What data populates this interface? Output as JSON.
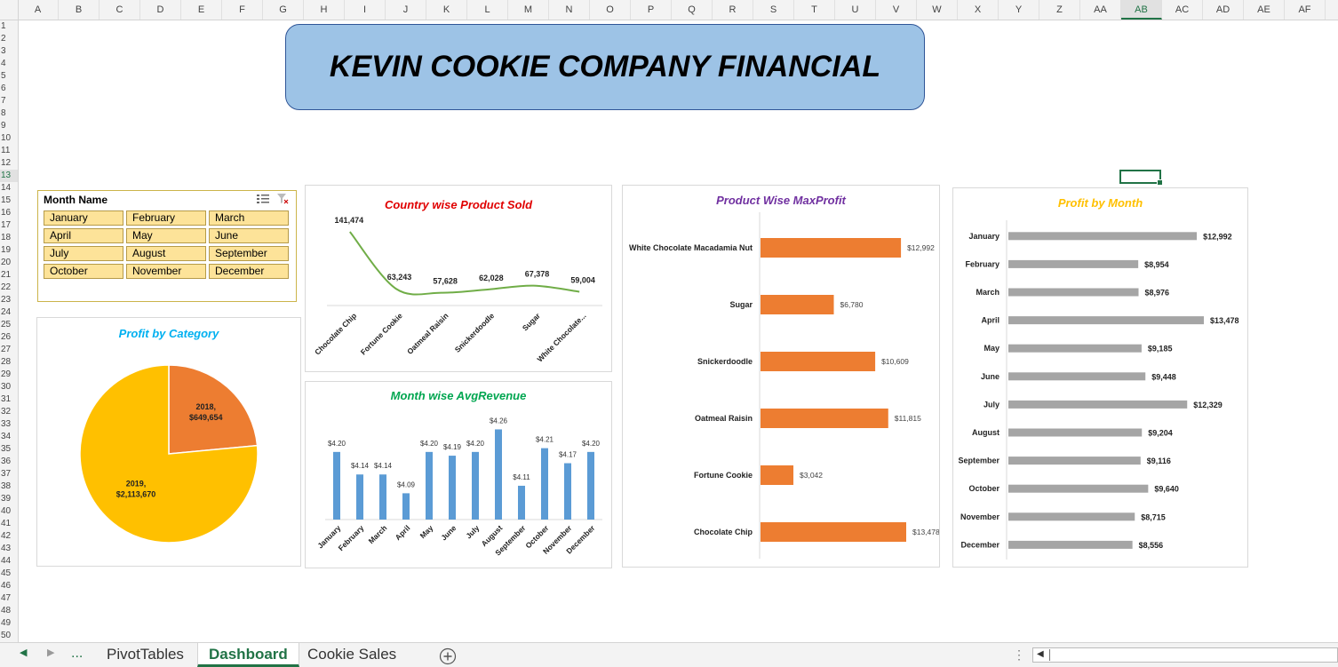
{
  "grid": {
    "columns": [
      "A",
      "B",
      "C",
      "D",
      "E",
      "F",
      "G",
      "H",
      "I",
      "J",
      "K",
      "L",
      "M",
      "N",
      "O",
      "P",
      "Q",
      "R",
      "S",
      "T",
      "U",
      "V",
      "W",
      "X",
      "Y",
      "Z",
      "AA",
      "AB",
      "AC",
      "AD",
      "AE",
      "AF"
    ],
    "selected_column": "AB",
    "rows": [
      "1",
      "2",
      "3",
      "4",
      "5",
      "6",
      "7",
      "8",
      "9",
      "10",
      "11",
      "12",
      "13",
      "14",
      "15",
      "16",
      "17",
      "18",
      "19",
      "20",
      "21",
      "22",
      "23",
      "24",
      "25",
      "26",
      "27",
      "28",
      "29",
      "30",
      "31",
      "32",
      "33",
      "34",
      "35",
      "36",
      "37",
      "38",
      "39",
      "40",
      "41",
      "42",
      "43",
      "44",
      "45",
      "46",
      "47",
      "48",
      "49",
      "50"
    ],
    "selected_row": "13"
  },
  "dashboard": {
    "title": "KEVIN COOKIE COMPANY FINANCIAL"
  },
  "slicer": {
    "title": "Month Name",
    "items": [
      "January",
      "February",
      "March",
      "April",
      "May",
      "June",
      "July",
      "August",
      "September",
      "October",
      "November",
      "December"
    ],
    "icons": [
      "multi-select-icon",
      "clear-filter-icon"
    ]
  },
  "charts": {
    "country_product_sold": {
      "title": "Country wise Product Sold",
      "title_color": "#e00000"
    },
    "month_avg_revenue": {
      "title": "Month wise AvgRevenue",
      "title_color": "#00a650"
    },
    "product_max_profit": {
      "title": "Product Wise MaxProfit",
      "title_color": "#7030a0"
    },
    "profit_by_month": {
      "title": "Profit by Month",
      "title_color": "#ffc000"
    },
    "profit_by_category": {
      "title": "Profit by Category",
      "title_color": "#00b0f0"
    }
  },
  "chart_data": [
    {
      "id": "country_product_sold",
      "type": "line",
      "title": "Country wise Product Sold",
      "categories": [
        "Chocolate Chip",
        "Fortune Cookie",
        "Oatmeal Raisin",
        "Snickerdoodle",
        "Sugar",
        "White Chocolate..."
      ],
      "values": [
        141474,
        63243,
        57628,
        62028,
        67378,
        59004
      ],
      "labels": [
        "141,474",
        "63,243",
        "57,628",
        "62,028",
        "67,378",
        "59,004"
      ],
      "color": "#70ad47",
      "smooth": true
    },
    {
      "id": "month_avg_revenue",
      "type": "bar",
      "title": "Month wise AvgRevenue",
      "categories": [
        "January",
        "February",
        "March",
        "April",
        "May",
        "June",
        "July",
        "August",
        "September",
        "October",
        "November",
        "December"
      ],
      "values": [
        4.2,
        4.14,
        4.14,
        4.09,
        4.2,
        4.19,
        4.2,
        4.26,
        4.11,
        4.21,
        4.17,
        4.2
      ],
      "labels": [
        "$4.20",
        "$4.14",
        "$4.14",
        "$4.09",
        "$4.20",
        "$4.19",
        "$4.20",
        "$4.26",
        "$4.11",
        "$4.21",
        "$4.17",
        "$4.20"
      ],
      "color": "#5b9bd5"
    },
    {
      "id": "product_max_profit",
      "type": "bar",
      "orientation": "horizontal",
      "title": "Product Wise MaxProfit",
      "categories": [
        "White Chocolate Macadamia Nut",
        "Sugar",
        "Snickerdoodle",
        "Oatmeal Raisin",
        "Fortune Cookie",
        "Chocolate Chip"
      ],
      "values": [
        12992,
        6780,
        10609,
        11815,
        3042,
        13478
      ],
      "labels": [
        "$12,992",
        "$6,780",
        "$10,609",
        "$11,815",
        "$3,042",
        "$13,478"
      ],
      "color": "#ed7d31"
    },
    {
      "id": "profit_by_month",
      "type": "bar",
      "orientation": "horizontal",
      "title": "Profit by Month",
      "categories": [
        "January",
        "February",
        "March",
        "April",
        "May",
        "June",
        "July",
        "August",
        "September",
        "October",
        "November",
        "December"
      ],
      "values": [
        12992,
        8954,
        8976,
        13478,
        9185,
        9448,
        12329,
        9204,
        9116,
        9640,
        8715,
        8556
      ],
      "labels": [
        "$12,992",
        "$8,954",
        "$8,976",
        "$13,478",
        "$9,185",
        "$9,448",
        "$12,329",
        "$9,204",
        "$9,116",
        "$9,640",
        "$8,715",
        "$8,556"
      ],
      "color": "#a5a5a5"
    },
    {
      "id": "profit_by_category",
      "type": "pie",
      "title": "Profit by Category",
      "slices": [
        {
          "name": "2018",
          "value": 649654,
          "label": "2018,",
          "value_label": "$649,654",
          "color": "#ed7d31"
        },
        {
          "name": "2019",
          "value": 2113670,
          "label": "2019,",
          "value_label": "$2,113,670",
          "color": "#ffc000"
        }
      ]
    }
  ],
  "sheet_tabs": {
    "ellipsis": "...",
    "tabs": [
      "PivotTables",
      "Dashboard",
      "Cookie Sales"
    ],
    "active": "Dashboard",
    "add_icon": "plus-circle-icon"
  }
}
